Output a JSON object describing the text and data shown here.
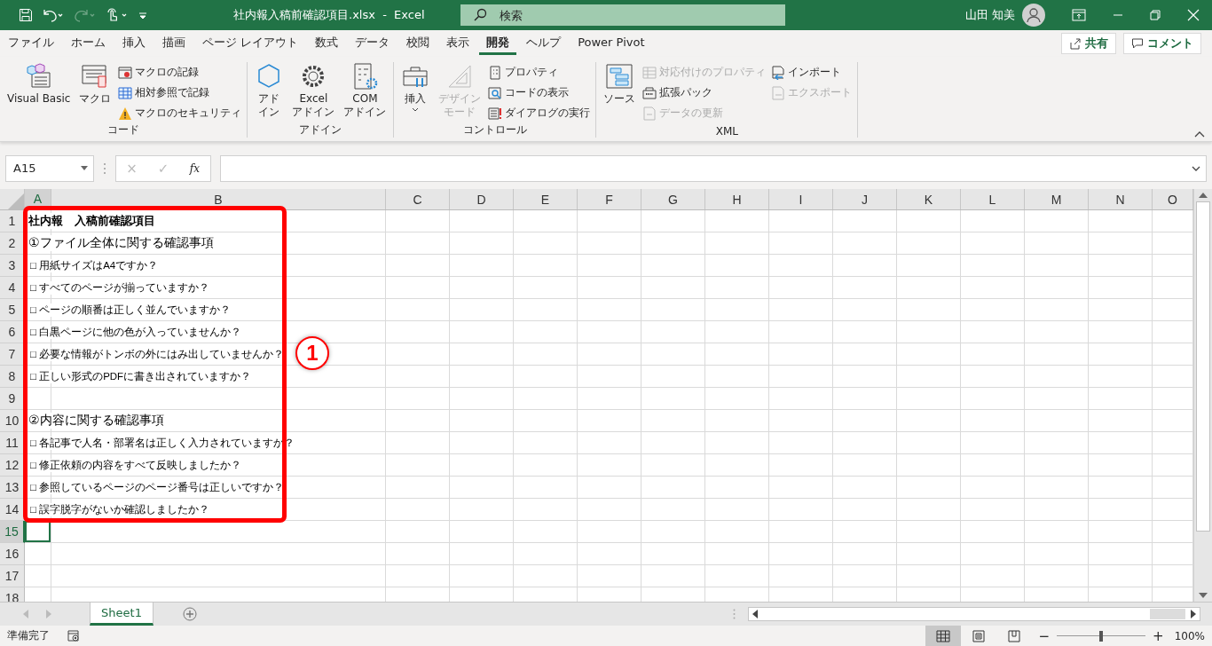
{
  "title_bar": {
    "quick_access": [
      {
        "disabled": false
      },
      {
        "disabled": true
      },
      {
        "disabled": false
      }
    ],
    "title": "社内報入稿前確認項目.xlsx  -  Excel",
    "search": {
      "placeholder": "検索"
    },
    "user": "山田 知美"
  },
  "menu_tabs": [
    {
      "label": "ファイル",
      "selected": false
    },
    {
      "label": "ホーム",
      "selected": false
    },
    {
      "label": "挿入",
      "selected": false
    },
    {
      "label": "描画",
      "selected": false
    },
    {
      "label": "ページ レイアウト",
      "selected": false
    },
    {
      "label": "数式",
      "selected": false
    },
    {
      "label": "データ",
      "selected": false
    },
    {
      "label": "校閲",
      "selected": false
    },
    {
      "label": "表示",
      "selected": false
    },
    {
      "label": "開発",
      "selected": true
    },
    {
      "label": "ヘルプ",
      "selected": false
    },
    {
      "label": "Power Pivot",
      "selected": false
    }
  ],
  "share_button": "共有",
  "comment_button": "コメント",
  "ribbon_groups": [
    {
      "label": "コード",
      "columns": [
        {
          "kind": "large",
          "lines": [
            "Visual Basic"
          ],
          "disabled": false
        },
        {
          "kind": "large",
          "lines": [
            "マクロ"
          ],
          "disabled": false
        },
        {
          "kind": "stack",
          "items": [
            {
              "label": "マクロの記録",
              "disabled": false
            },
            {
              "label": "相対参照で記録",
              "disabled": false
            },
            {
              "label": "マクロのセキュリティ",
              "disabled": false
            }
          ]
        }
      ]
    },
    {
      "label": "アドイン",
      "columns": [
        {
          "kind": "large",
          "lines": [
            "アド",
            "イン"
          ],
          "disabled": false
        },
        {
          "kind": "large",
          "lines": [
            "Excel",
            "アドイン"
          ],
          "disabled": false
        },
        {
          "kind": "large",
          "lines": [
            "COM",
            "アドイン"
          ],
          "disabled": false
        }
      ]
    },
    {
      "label": "コントロール",
      "columns": [
        {
          "kind": "large",
          "lines": [
            "挿入"
          ],
          "disabled": false
        },
        {
          "kind": "large",
          "lines": [
            "デザイン",
            "モード"
          ],
          "disabled": true
        },
        {
          "kind": "stack",
          "items": [
            {
              "label": "プロパティ",
              "disabled": false
            },
            {
              "label": "コードの表示",
              "disabled": false
            },
            {
              "label": "ダイアログの実行",
              "disabled": false
            }
          ]
        }
      ]
    },
    {
      "label": "XML",
      "columns": [
        {
          "kind": "large",
          "lines": [
            "ソース"
          ],
          "disabled": false
        },
        {
          "kind": "stack",
          "items": [
            {
              "label": "対応付けのプロパティ",
              "disabled": true
            },
            {
              "label": "拡張パック",
              "disabled": false
            },
            {
              "label": "データの更新",
              "disabled": true
            }
          ]
        },
        {
          "kind": "stack",
          "items": [
            {
              "label": "インポート",
              "disabled": false
            },
            {
              "label": "エクスポート",
              "disabled": true
            }
          ]
        }
      ]
    }
  ],
  "formula_bar": {
    "name_box": "A15",
    "cancel": "×",
    "enter": "✓",
    "function": "fx"
  },
  "columns": [
    {
      "label": "A",
      "selected": true
    },
    {
      "label": "B",
      "selected": false
    },
    {
      "label": "C",
      "selected": false
    },
    {
      "label": "D",
      "selected": false
    },
    {
      "label": "E",
      "selected": false
    },
    {
      "label": "F",
      "selected": false
    },
    {
      "label": "G",
      "selected": false
    },
    {
      "label": "H",
      "selected": false
    },
    {
      "label": "I",
      "selected": false
    },
    {
      "label": "J",
      "selected": false
    },
    {
      "label": "K",
      "selected": false
    },
    {
      "label": "L",
      "selected": false
    },
    {
      "label": "M",
      "selected": false
    },
    {
      "label": "N",
      "selected": false
    },
    {
      "label": "O",
      "selected": false
    }
  ],
  "rows": [
    {
      "n": "1",
      "kind": "title",
      "text": "社内報　入稿前確認項目",
      "selected": false
    },
    {
      "n": "2",
      "kind": "heading",
      "text": "①ファイル全体に関する確認事項",
      "selected": false
    },
    {
      "n": "3",
      "kind": "item",
      "text": "□ 用紙サイズはA4ですか？",
      "selected": false
    },
    {
      "n": "4",
      "kind": "item",
      "text": "□ すべてのページが揃っていますか？",
      "selected": false
    },
    {
      "n": "5",
      "kind": "item",
      "text": "□ ページの順番は正しく並んでいますか？",
      "selected": false
    },
    {
      "n": "6",
      "kind": "item",
      "text": "□ 白黒ページに他の色が入っていませんか？",
      "selected": false
    },
    {
      "n": "7",
      "kind": "item",
      "text": "□ 必要な情報がトンボの外にはみ出していませんか？",
      "selected": false
    },
    {
      "n": "8",
      "kind": "item",
      "text": "□ 正しい形式のPDFに書き出されていますか？",
      "selected": false
    },
    {
      "n": "9",
      "selected": false
    },
    {
      "n": "10",
      "kind": "heading",
      "text": "②内容に関する確認事項",
      "selected": false
    },
    {
      "n": "11",
      "kind": "item",
      "text": "□ 各記事で人名・部署名は正しく入力されていますか？",
      "selected": false
    },
    {
      "n": "12",
      "kind": "item",
      "text": "□ 修正依頼の内容をすべて反映しましたか？",
      "selected": false
    },
    {
      "n": "13",
      "kind": "item",
      "text": "□ 参照しているページのページ番号は正しいですか？",
      "selected": false
    },
    {
      "n": "14",
      "kind": "item",
      "text": "□ 誤字脱字がないか確認しましたか？",
      "selected": false
    },
    {
      "n": "15",
      "selected": true
    },
    {
      "n": "16",
      "selected": false
    },
    {
      "n": "17",
      "selected": false
    },
    {
      "n": "18",
      "selected": false
    }
  ],
  "callout": "1",
  "sheet_tabs": [
    {
      "label": "Sheet1",
      "selected": true
    }
  ],
  "status_bar": {
    "status": "準備完了",
    "views": [
      {
        "selected": true
      },
      {
        "selected": false
      },
      {
        "selected": false
      }
    ],
    "zoom_out": "−",
    "zoom_in": "+",
    "zoom": {
      "level": 0.5
    },
    "zoom_text": "100%"
  }
}
